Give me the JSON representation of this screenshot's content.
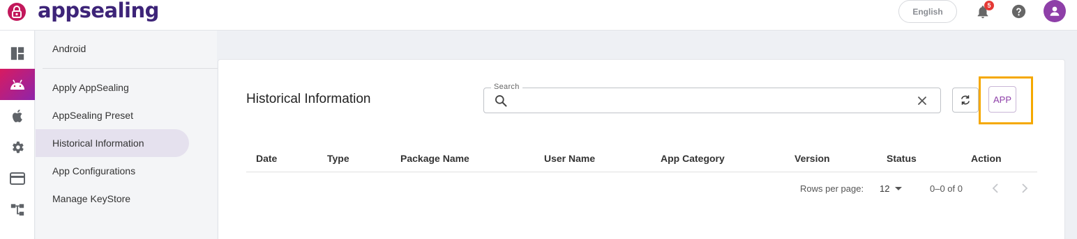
{
  "header": {
    "brand": "appsealing",
    "language_label": "English",
    "notification_count": "5",
    "icons": [
      "appsealing-logo-icon",
      "bell-icon",
      "help-icon",
      "user-icon"
    ]
  },
  "rail": {
    "items": [
      {
        "name": "dashboard-icon"
      },
      {
        "name": "android-icon",
        "active": true
      },
      {
        "name": "apple-icon"
      },
      {
        "name": "settings-icon"
      },
      {
        "name": "billing-card-icon"
      },
      {
        "name": "hierarchy-icon"
      }
    ]
  },
  "subnav": {
    "title": "Android",
    "items": [
      {
        "label": "Apply AppSealing"
      },
      {
        "label": "AppSealing Preset"
      },
      {
        "label": "Historical Information",
        "active": true
      },
      {
        "label": "App Configurations"
      },
      {
        "label": "Manage KeyStore"
      }
    ]
  },
  "main": {
    "title": "Historical Information",
    "search": {
      "label": "Search",
      "value": "",
      "placeholder": ""
    },
    "app_button_label": "APP",
    "table": {
      "columns": [
        "Date",
        "Type",
        "Package Name",
        "User Name",
        "App Category",
        "Version",
        "Status",
        "Action"
      ],
      "rows": []
    },
    "pagination": {
      "rows_per_page_label": "Rows per page:",
      "rows_per_page_value": "12",
      "range_text": "0–0 of 0"
    }
  },
  "colors": {
    "brand": "#3d2478",
    "accent": "#8e3fa8",
    "highlight": "#f5a800",
    "badge": "#e53935"
  }
}
